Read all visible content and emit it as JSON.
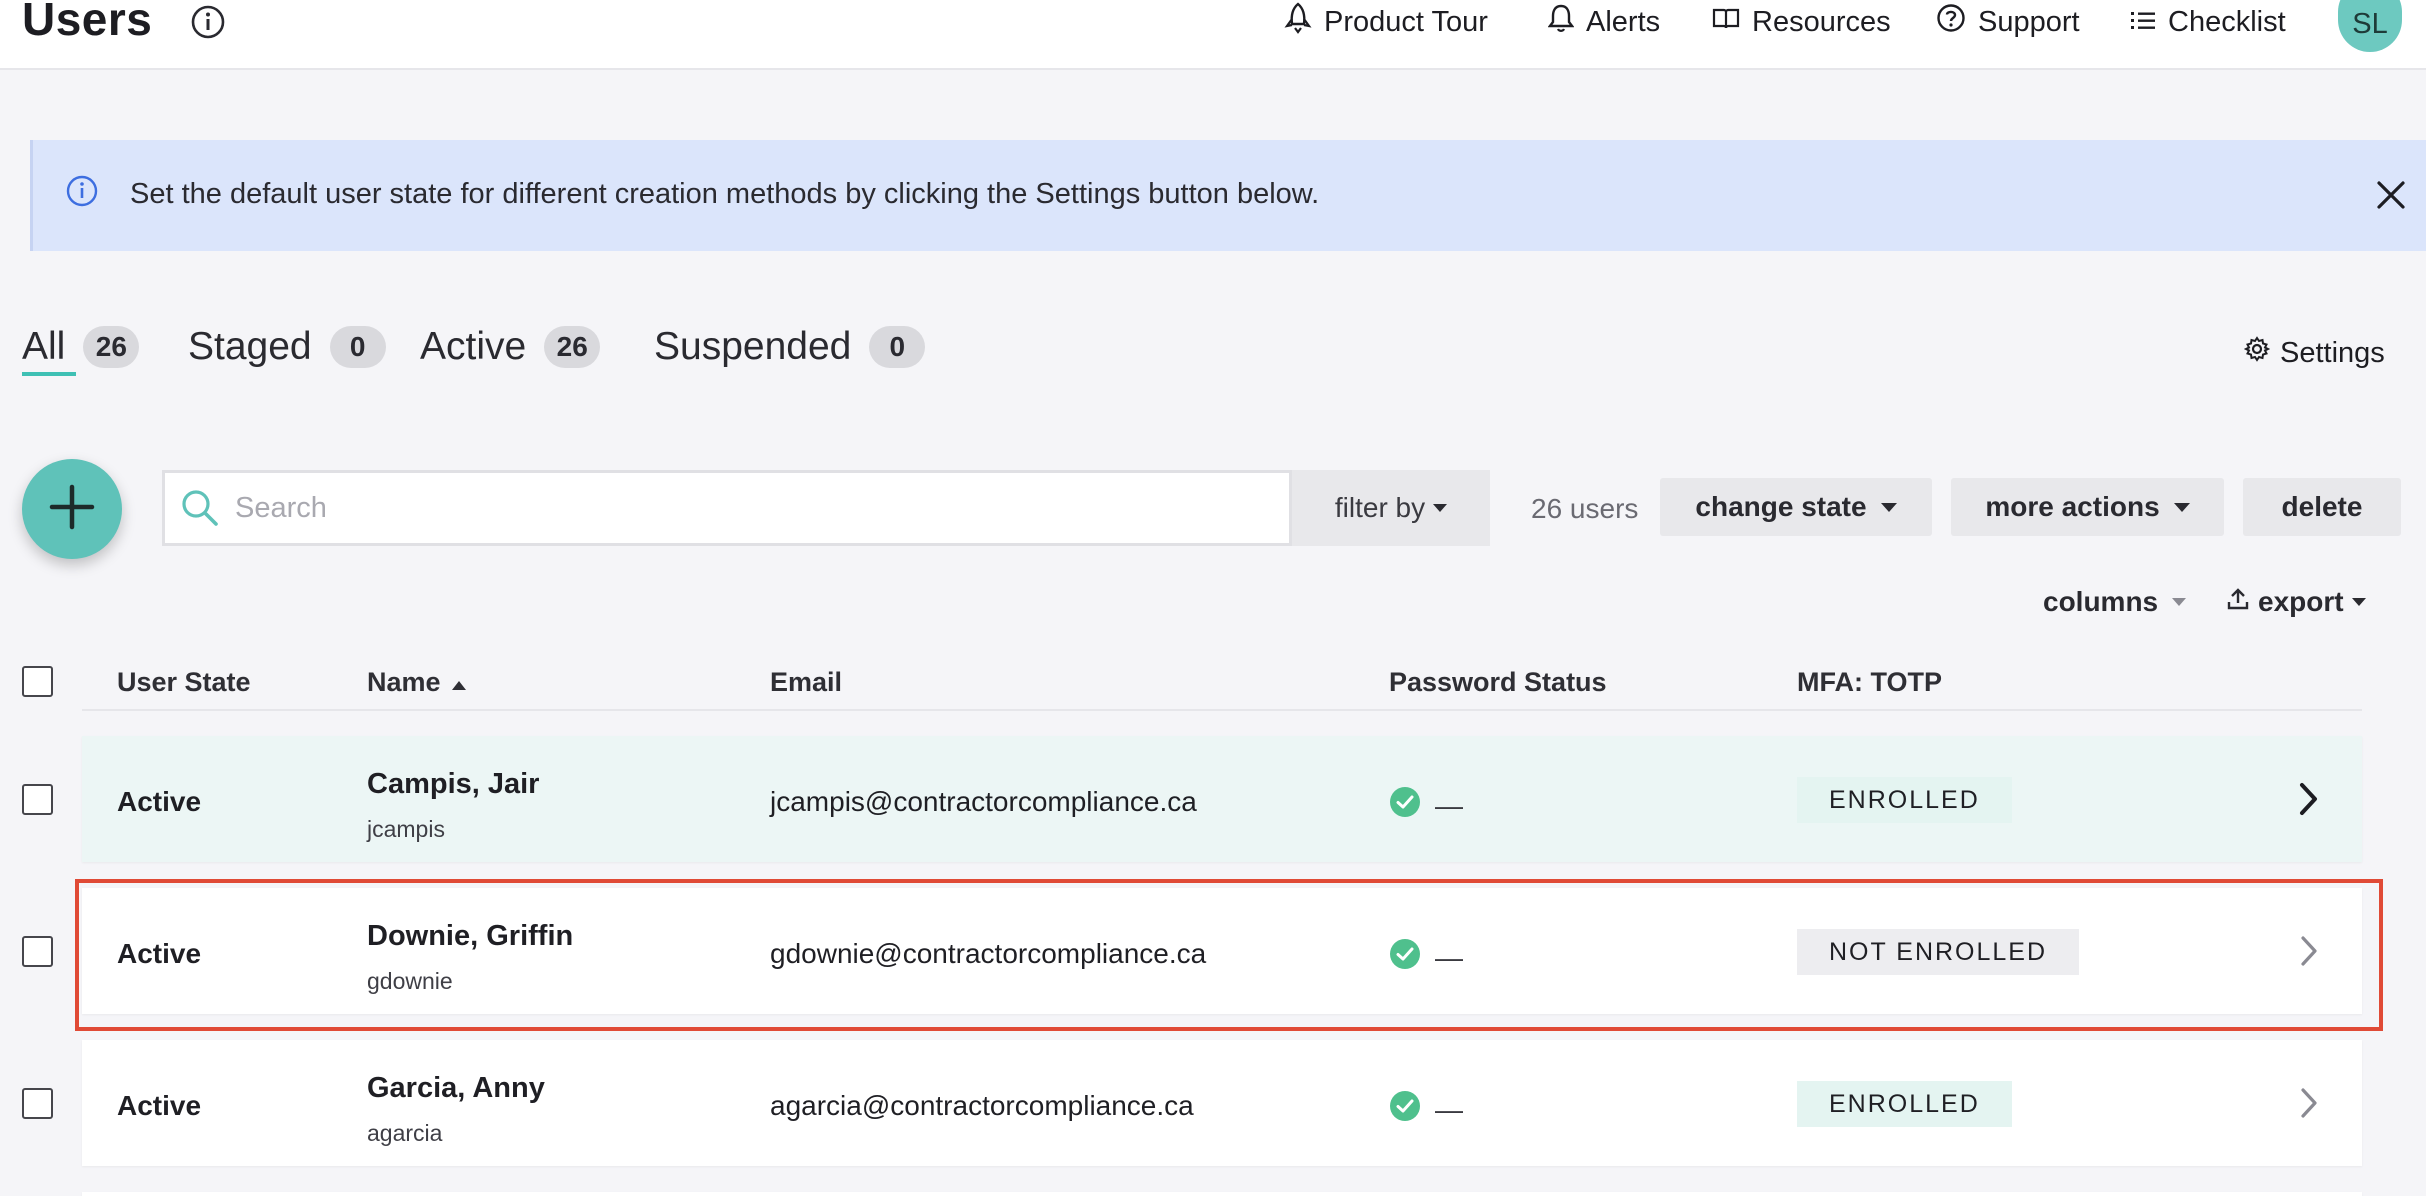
{
  "header": {
    "title": "Users",
    "nav": {
      "product_tour": "Product Tour",
      "alerts": "Alerts",
      "resources": "Resources",
      "support": "Support",
      "checklist": "Checklist"
    },
    "avatar_initials": "SL"
  },
  "banner": {
    "text": "Set the default user state for different creation methods by clicking the Settings button below."
  },
  "tabs": [
    {
      "label": "All",
      "count": "26",
      "active": true
    },
    {
      "label": "Staged",
      "count": "0"
    },
    {
      "label": "Active",
      "count": "26"
    },
    {
      "label": "Suspended",
      "count": "0"
    }
  ],
  "settings_label": "Settings",
  "toolbar": {
    "search_placeholder": "Search",
    "filter_label": "filter by",
    "users_count": "26 users",
    "change_state": "change state",
    "more_actions": "more actions",
    "delete": "delete",
    "columns": "columns",
    "export": "export"
  },
  "table": {
    "headers": {
      "user_state": "User State",
      "name": "Name",
      "email": "Email",
      "password_status": "Password Status",
      "mfa": "MFA: TOTP"
    },
    "sort": {
      "column": "name",
      "direction": "ascending"
    },
    "rows": [
      {
        "state": "Active",
        "name": "Campis, Jair",
        "login": "jcampis",
        "email": "jcampis@contractorcompliance.ca",
        "password_status": "—",
        "mfa": "ENROLLED"
      },
      {
        "state": "Active",
        "name": "Downie, Griffin",
        "login": "gdownie",
        "email": "gdownie@contractorcompliance.ca",
        "password_status": "—",
        "mfa": "NOT ENROLLED"
      },
      {
        "state": "Active",
        "name": "Garcia, Anny",
        "login": "agarcia",
        "email": "agarcia@contractorcompliance.ca",
        "password_status": "—",
        "mfa": "ENROLLED"
      }
    ]
  },
  "colors": {
    "accent": "#5fc2b9",
    "banner_bg": "#dbe5fb",
    "highlight_row": "#ecf6f5",
    "selection_outline": "#e04a36",
    "check_green": "#4fc08d"
  },
  "icons": {
    "title_info": "info-icon",
    "product_tour": "rocket-icon",
    "alerts": "bell-icon",
    "resources": "book-icon",
    "support": "question-circle-icon",
    "checklist": "list-icon",
    "banner": "info-icon",
    "banner_close": "close-icon",
    "settings": "gear-icon",
    "add": "plus-icon",
    "search": "search-icon",
    "export": "upload-icon",
    "password_ok": "check-circle-icon",
    "row_open": "chevron-right-icon"
  }
}
